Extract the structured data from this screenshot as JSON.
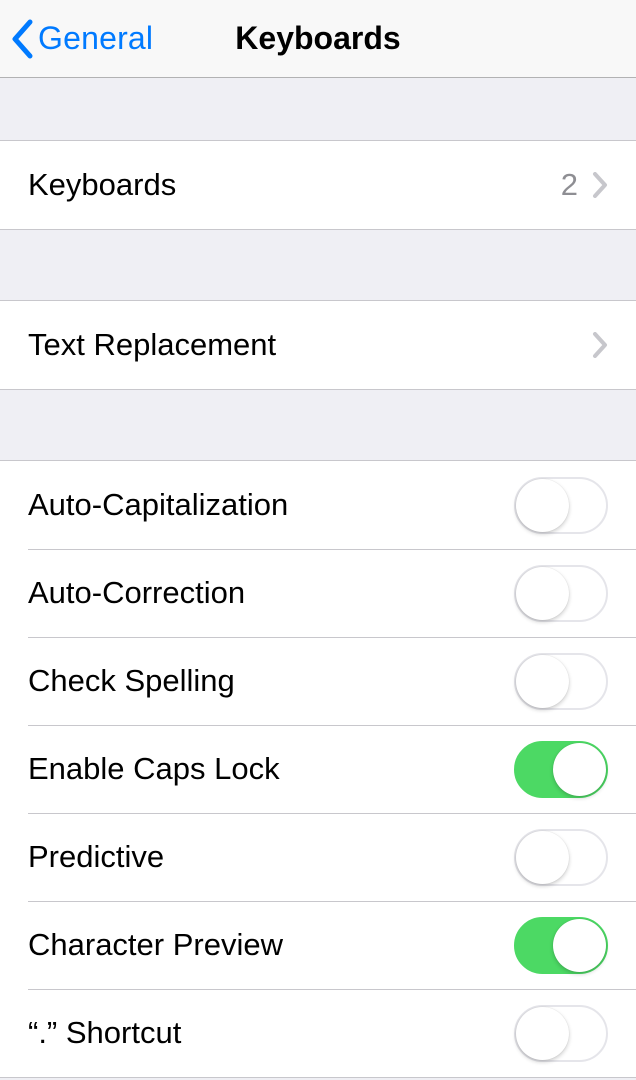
{
  "navbar": {
    "back_label": "General",
    "title": "Keyboards"
  },
  "group1": {
    "keyboards": {
      "label": "Keyboards",
      "value": "2"
    }
  },
  "group2": {
    "text_replacement": {
      "label": "Text Replacement"
    }
  },
  "settings": {
    "auto_capitalization": {
      "label": "Auto-Capitalization",
      "on": false
    },
    "auto_correction": {
      "label": "Auto-Correction",
      "on": false
    },
    "check_spelling": {
      "label": "Check Spelling",
      "on": false
    },
    "enable_caps_lock": {
      "label": "Enable Caps Lock",
      "on": true
    },
    "predictive": {
      "label": "Predictive",
      "on": false
    },
    "character_preview": {
      "label": "Character Preview",
      "on": true
    },
    "period_shortcut": {
      "label": "“.” Shortcut",
      "on": false
    }
  }
}
